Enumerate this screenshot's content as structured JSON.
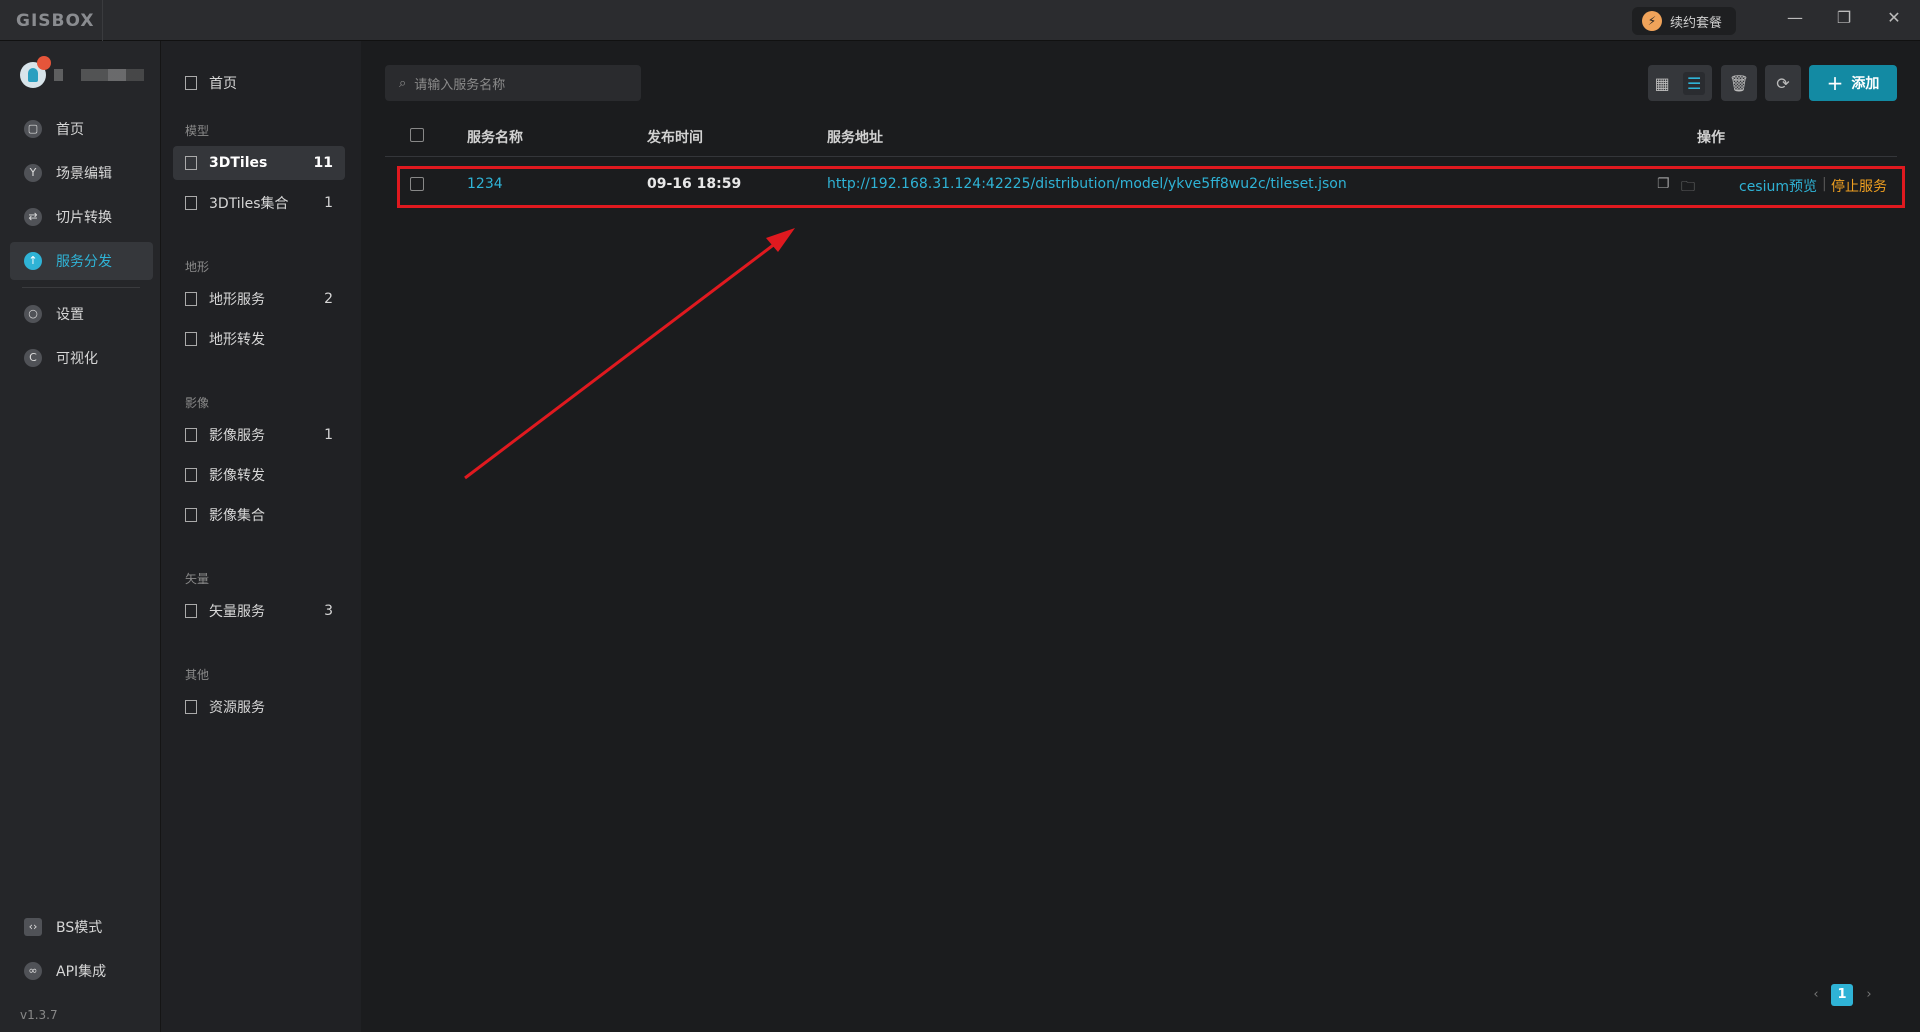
{
  "app": {
    "logo": "GISBOX",
    "renew": "续约套餐",
    "minimize": "—",
    "restore": "❐",
    "close": "✕",
    "version": "v1.3.7"
  },
  "nav": {
    "items": [
      {
        "label": "首页",
        "icon": "home-icon"
      },
      {
        "label": "场景编辑",
        "icon": "cube-icon"
      },
      {
        "label": "切片转换",
        "icon": "swap-icon"
      },
      {
        "label": "服务分发",
        "icon": "upload-icon",
        "active": true
      },
      {
        "label": "设置",
        "icon": "gear-icon"
      },
      {
        "label": "可视化",
        "icon": "chart-icon"
      }
    ],
    "bottom": [
      {
        "label": "BS模式",
        "icon": "code-icon"
      },
      {
        "label": "API集成",
        "icon": "link-icon"
      }
    ]
  },
  "subnav": {
    "home": "首页",
    "sections": [
      {
        "title": "模型",
        "items": [
          {
            "label": "3DTiles",
            "count": "11",
            "active": true
          },
          {
            "label": "3DTiles集合",
            "count": "1"
          }
        ]
      },
      {
        "title": "地形",
        "items": [
          {
            "label": "地形服务",
            "count": "2"
          },
          {
            "label": "地形转发",
            "count": ""
          }
        ]
      },
      {
        "title": "影像",
        "items": [
          {
            "label": "影像服务",
            "count": "1"
          },
          {
            "label": "影像转发",
            "count": ""
          },
          {
            "label": "影像集合",
            "count": ""
          }
        ]
      },
      {
        "title": "矢量",
        "items": [
          {
            "label": "矢量服务",
            "count": "3"
          }
        ]
      },
      {
        "title": "其他",
        "items": [
          {
            "label": "资源服务",
            "count": ""
          }
        ]
      }
    ]
  },
  "search": {
    "placeholder": "请输入服务名称"
  },
  "toolbar": {
    "add": "添加"
  },
  "table": {
    "headers": [
      "服务名称",
      "发布时间",
      "服务地址",
      "操作"
    ],
    "rows": [
      {
        "name": "1234",
        "time": "09-16 18:59",
        "url": "http://192.168.31.124:42225/distribution/model/ykve5ff8wu2c/tileset.json",
        "preview": "cesium预览",
        "stop": "停止服务"
      }
    ]
  },
  "pagination": {
    "current": "1"
  },
  "colors": {
    "accent": "#2fb3d6",
    "highlight": "#e0191f",
    "warn": "#f0a020"
  }
}
